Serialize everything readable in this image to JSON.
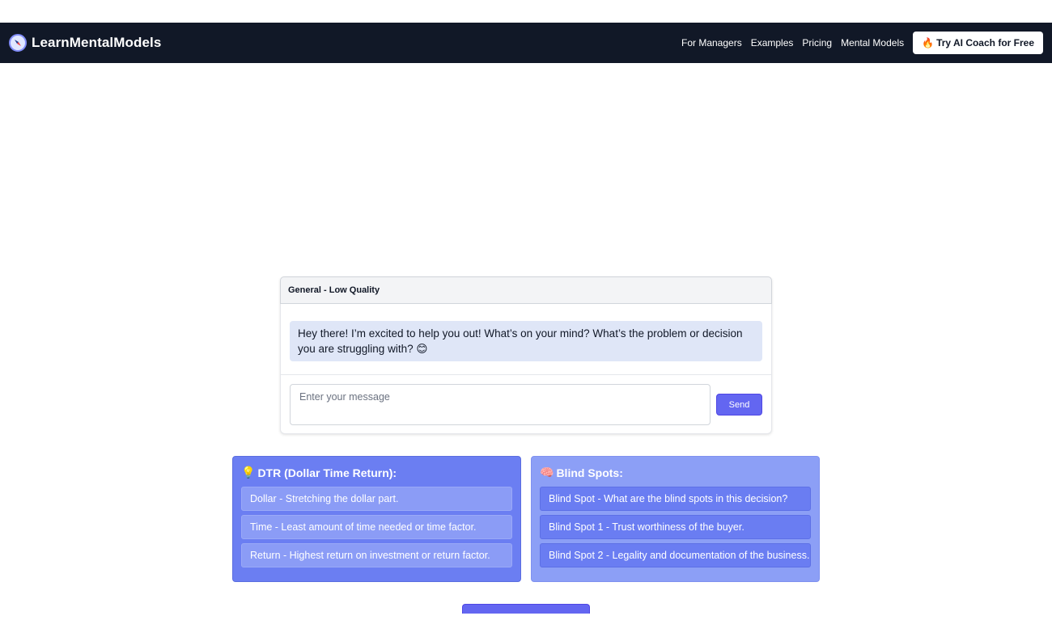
{
  "nav": {
    "brand": "LearnMentalModels",
    "links": [
      "For Managers",
      "Examples",
      "Pricing",
      "Mental Models"
    ],
    "cta": "Try AI Coach for Free",
    "cta_emoji": "🔥"
  },
  "chat": {
    "header": "General - Low Quality",
    "message": "Hey there! I’m excited to help you out! What’s on your mind? What’s the problem or decision you are struggling with? 😊",
    "input_placeholder": "Enter your message",
    "send_label": "Send"
  },
  "cards": {
    "dtr": {
      "emoji": "💡",
      "title": "DTR (Dollar Time Return):",
      "items": [
        "Dollar - Stretching the dollar part.",
        "Time - Least amount of time needed or time factor.",
        "Return - Highest return on investment or return factor."
      ]
    },
    "blind": {
      "emoji": "🧠",
      "title": "Blind Spots:",
      "items": [
        "Blind Spot - What are the blind spots in this decision?",
        "Blind Spot 1 - Trust worthiness of the buyer.",
        "Blind Spot 2 - Legality and documentation of the business."
      ]
    }
  },
  "colors": {
    "navbar": "#111827",
    "accent": "#6366f1",
    "dtr_card": "#6b7ef2",
    "blind_card": "#8c9ff6",
    "bubble": "#dfe6f7"
  },
  "icons": {
    "brand": "compass-icon"
  }
}
